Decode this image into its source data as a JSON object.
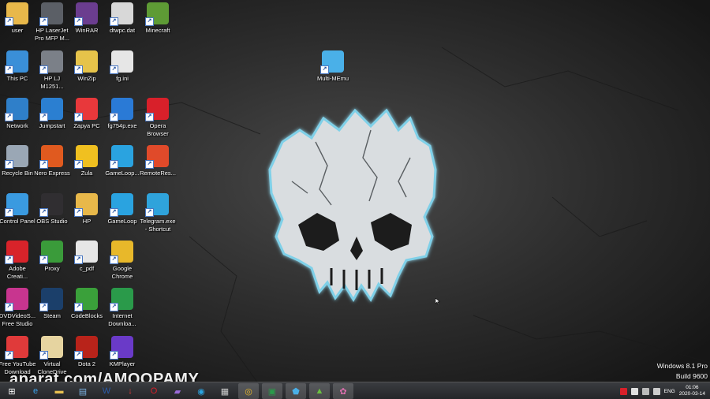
{
  "desktop": {
    "icons": [
      {
        "label": "user",
        "icon": "folder-icon",
        "color": "#e8b84a"
      },
      {
        "label": "HP LaserJet\nPro MFP M...",
        "icon": "hp-logo-icon",
        "color": "#5b5f66"
      },
      {
        "label": "WinRAR",
        "icon": "winrar-icon",
        "color": "#6b3d8f"
      },
      {
        "label": "dtwpc.dat",
        "icon": "dat-file-icon",
        "color": "#d8d8d8"
      },
      {
        "label": "Minecraft",
        "icon": "minecraft-icon",
        "color": "#5e9b35"
      },
      {
        "label": "This PC",
        "icon": "computer-icon",
        "color": "#3a8fd8"
      },
      {
        "label": "HP LJ\nM1251...",
        "icon": "printer-icon",
        "color": "#7b8088"
      },
      {
        "label": "WinZip",
        "icon": "winzip-icon",
        "color": "#e6c34a"
      },
      {
        "label": "fg.ini",
        "icon": "ini-file-icon",
        "color": "#e6e6e6"
      },
      {
        "label": "Network",
        "icon": "network-icon",
        "color": "#2f7fc9"
      },
      {
        "label": "Jumpstart",
        "icon": "jumpstart-icon",
        "color": "#2b7fd1"
      },
      {
        "label": "Zapya PC",
        "icon": "zapya-icon",
        "color": "#e8383b"
      },
      {
        "label": "fg754p.exe",
        "icon": "exe-icon",
        "color": "#2a7ad6"
      },
      {
        "label": "Opera\nBrowser",
        "icon": "opera-icon",
        "color": "#d8202a"
      },
      {
        "label": "Recycle Bin",
        "icon": "recycle-bin-icon",
        "color": "#9aa7b5"
      },
      {
        "label": "Nero Express",
        "icon": "nero-icon",
        "color": "#e05a1f"
      },
      {
        "label": "Zula",
        "icon": "zula-icon",
        "color": "#f0c020"
      },
      {
        "label": "GameLoop...",
        "icon": "gameloop-icon",
        "color": "#2aa3e0"
      },
      {
        "label": "RemoteRes...",
        "icon": "remote-file-icon",
        "color": "#e04a2a"
      },
      {
        "label": "Control Panel",
        "icon": "control-panel-icon",
        "color": "#3a9ae0"
      },
      {
        "label": "OBS Studio",
        "icon": "obs-icon",
        "color": "#302e31"
      },
      {
        "label": "HP",
        "icon": "folder-icon",
        "color": "#e8b84a"
      },
      {
        "label": "GameLoop",
        "icon": "gameloop-icon",
        "color": "#2aa3e0"
      },
      {
        "label": "Telegram.exe\n- Shortcut",
        "icon": "telegram-icon",
        "color": "#2fa3db"
      },
      {
        "label": "Adobe\nCreati...",
        "icon": "adobe-cc-icon",
        "color": "#d8232a"
      },
      {
        "label": "Proxy",
        "icon": "globe-icon",
        "color": "#3a9b3a"
      },
      {
        "label": "c_pdf",
        "icon": "pdf-file-icon",
        "color": "#e6e6e6"
      },
      {
        "label": "Google\nChrome",
        "icon": "chrome-icon",
        "color": "#e8b82a"
      },
      {
        "label": "DVDVideoS...\nFree Studio",
        "icon": "dvdvideosoft-icon",
        "color": "#c8358f"
      },
      {
        "label": "Steam",
        "icon": "steam-icon",
        "color": "#1b3f6a"
      },
      {
        "label": "CodeBlocks",
        "icon": "codeblocks-icon",
        "color": "#3aa03a"
      },
      {
        "label": "Internet\nDownloa...",
        "icon": "idm-icon",
        "color": "#2a9a4a"
      },
      {
        "label": "Free YouTube\nDownload",
        "icon": "download-icon",
        "color": "#e03a3a"
      },
      {
        "label": "Virtual\nCloneDrive",
        "icon": "sheep-icon",
        "color": "#e6d4a0"
      },
      {
        "label": "Dota 2",
        "icon": "dota-icon",
        "color": "#b8231a"
      },
      {
        "label": "KMPlayer",
        "icon": "kmplayer-icon",
        "color": "#6a3ac8"
      },
      {
        "label": "Multi-MEmu",
        "icon": "memu-icon",
        "color": "#4ab0e8"
      }
    ]
  },
  "watermark": "aparat.com/AMOOPAMY",
  "windows_version": {
    "line1": "Windows 8.1 Pro",
    "line2": "Build 9600"
  },
  "taskbar": {
    "apps": [
      {
        "name": "start-button",
        "glyph": "⊞",
        "color": "#ffffff"
      },
      {
        "name": "internet-explorer-icon",
        "glyph": "e",
        "color": "#3aa0e8"
      },
      {
        "name": "file-explorer-icon",
        "glyph": "▬",
        "color": "#e8c050"
      },
      {
        "name": "notepad-icon",
        "glyph": "▤",
        "color": "#7ab0e0"
      },
      {
        "name": "word-icon",
        "glyph": "W",
        "color": "#2a5aa8"
      },
      {
        "name": "youtube-download-icon",
        "glyph": "↓",
        "color": "#e03a3a"
      },
      {
        "name": "opera-icon",
        "glyph": "O",
        "color": "#d8202a"
      },
      {
        "name": "app-icon",
        "glyph": "▰",
        "color": "#9a6ad8"
      },
      {
        "name": "gameloop-icon",
        "glyph": "◉",
        "color": "#2aa3e0"
      },
      {
        "name": "calendar-icon",
        "glyph": "▦",
        "color": "#cccccc"
      },
      {
        "name": "chrome-icon",
        "glyph": "◎",
        "color": "#e8b82a"
      },
      {
        "name": "excel-icon",
        "glyph": "▣",
        "color": "#2a9a4a"
      },
      {
        "name": "memu-icon",
        "glyph": "⬟",
        "color": "#4ab0e8"
      },
      {
        "name": "bluestacks-icon",
        "glyph": "▲",
        "color": "#6ac040"
      },
      {
        "name": "memu-alt-icon",
        "glyph": "✿",
        "color": "#e070b0"
      }
    ],
    "tray": {
      "language": "ENG",
      "time": "01:06",
      "date": "2020-03-14"
    }
  }
}
